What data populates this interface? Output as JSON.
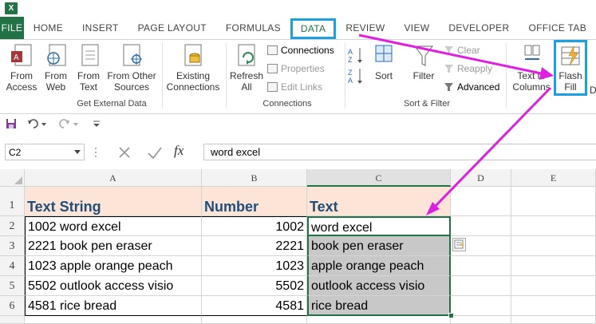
{
  "app": {
    "icon": "excel-icon",
    "accent": "#217346"
  },
  "tabs": [
    "FILE",
    "HOME",
    "INSERT",
    "PAGE LAYOUT",
    "FORMULAS",
    "DATA",
    "REVIEW",
    "VIEW",
    "DEVELOPER",
    "OFFICE TAB"
  ],
  "active_tab": "DATA",
  "ribbon": {
    "get_external_data": {
      "label": "Get External Data",
      "buttons": [
        {
          "line1": "From",
          "line2": "Access",
          "icon": "access-icon"
        },
        {
          "line1": "From",
          "line2": "Web",
          "icon": "web-icon"
        },
        {
          "line1": "From",
          "line2": "Text",
          "icon": "text-file-icon"
        },
        {
          "line1": "From Other",
          "line2": "Sources",
          "icon": "other-sources-icon"
        },
        {
          "line1": "Existing",
          "line2": "Connections",
          "icon": "existing-connections-icon"
        }
      ]
    },
    "connections": {
      "label": "Connections",
      "refresh": {
        "line1": "Refresh",
        "line2": "All"
      },
      "items": [
        "Connections",
        "Properties",
        "Edit Links"
      ]
    },
    "sort_filter": {
      "label": "Sort & Filter",
      "sort": "Sort",
      "filter": "Filter",
      "items": [
        "Clear",
        "Reapply",
        "Advanced"
      ]
    },
    "data_tools": {
      "text_to_columns": {
        "line1": "Text to",
        "line2": "Columns"
      },
      "flash_fill": {
        "line1": "Flash",
        "line2": "Fill"
      },
      "truncated": "D"
    }
  },
  "formula_bar": {
    "name_box": "C2",
    "fx": "fx",
    "formula": "word excel"
  },
  "columns": [
    "A",
    "B",
    "C",
    "D",
    "E"
  ],
  "rows": [
    "1",
    "2",
    "3",
    "4",
    "5",
    "6"
  ],
  "headers": {
    "A": "Text String",
    "B": "Number",
    "C": "Text"
  },
  "data": [
    {
      "a": "1002 word excel",
      "b": "1002",
      "c": "word excel"
    },
    {
      "a": "2221 book pen eraser",
      "b": "2221",
      "c": "book pen eraser"
    },
    {
      "a": "1023 apple orange peach",
      "b": "1023",
      "c": "apple orange peach"
    },
    {
      "a": "5502 outlook access visio",
      "b": "5502",
      "c": "outlook access visio"
    },
    {
      "a": "4581 rice bread",
      "b": "4581",
      "c": "rice bread"
    }
  ],
  "colors": {
    "header_fill": "#fce4d6",
    "header_text": "#1f4e79",
    "selection": "#c8c8c8",
    "highlight": "#1ca0e0",
    "arrow": "#e020e0"
  }
}
